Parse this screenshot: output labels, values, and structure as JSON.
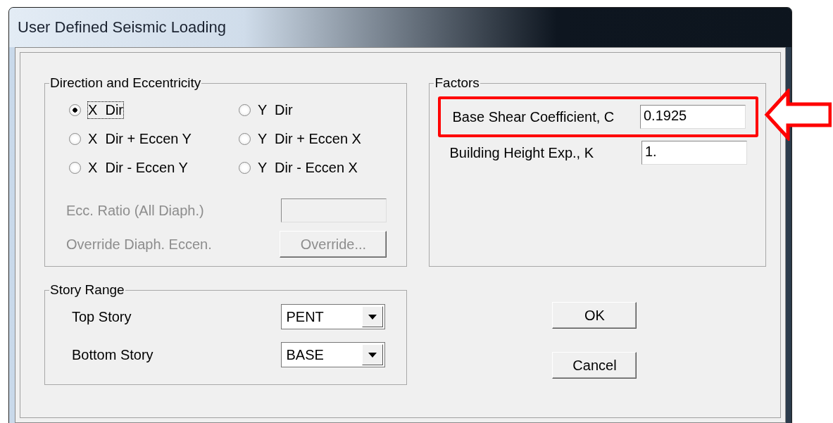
{
  "window": {
    "title": "User Defined Seismic Loading"
  },
  "direction_group": {
    "title": "Direction and Eccentricity",
    "options": [
      {
        "label": "X  Dir",
        "selected": true
      },
      {
        "label": "Y  Dir",
        "selected": false
      },
      {
        "label": "X  Dir + Eccen Y",
        "selected": false
      },
      {
        "label": "Y  Dir + Eccen X",
        "selected": false
      },
      {
        "label": "X  Dir - Eccen Y",
        "selected": false
      },
      {
        "label": "Y  Dir - Eccen X",
        "selected": false
      }
    ],
    "ecc_ratio": {
      "label": "Ecc. Ratio (All Diaph.)",
      "disabled": true
    },
    "override": {
      "label": "Override Diaph. Eccen.",
      "button": "Override...",
      "disabled": true
    }
  },
  "factors": {
    "title": "Factors",
    "fields": [
      {
        "label": "Base Shear Coefficient, C",
        "value": "0.1925",
        "highlighted": true
      },
      {
        "label": "Building Height Exp., K",
        "value": "1.",
        "highlighted": false
      }
    ]
  },
  "story_range": {
    "title": "Story Range",
    "rows": [
      {
        "label": "Top Story",
        "value": "PENT"
      },
      {
        "label": "Bottom Story",
        "value": "BASE"
      }
    ]
  },
  "buttons": [
    "OK",
    "Cancel"
  ]
}
